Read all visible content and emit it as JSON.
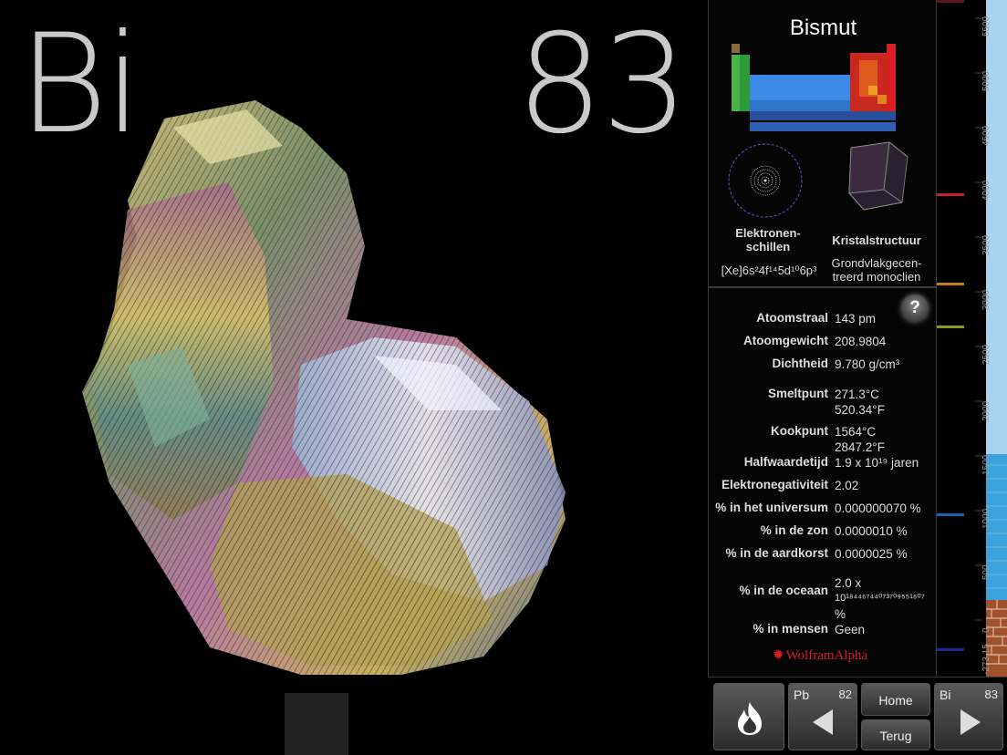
{
  "element": {
    "symbol": "Bi",
    "atomic_number": "83",
    "name": "Bismut"
  },
  "diagrams": {
    "shells_caption": [
      "Elektronen-",
      "schillen"
    ],
    "crystal_caption": "Kristalstructuur",
    "electron_config": "[Xe]6s²4f¹⁴5d¹⁰6p³",
    "crystal_structure": [
      "Grondvlakgecen-",
      "treerd monoclien"
    ]
  },
  "help_label": "?",
  "properties": [
    {
      "label": "Atoomstraal",
      "value": "143 pm"
    },
    {
      "label": "Atoomgewicht",
      "value": "208.9804"
    },
    {
      "label": "Dichtheid",
      "value": "9.780 g/cm³"
    },
    {
      "label": "Smeltpunt",
      "value": "271.3°C",
      "value2": "520.34°F"
    },
    {
      "label": "Kookpunt",
      "value": "1564°C",
      "value2": "2847.2°F"
    },
    {
      "label": "Halfwaardetijd",
      "value": "1.9 x 10¹⁹ jaren"
    },
    {
      "label": "Elektronegativiteit",
      "value": "2.02"
    },
    {
      "label": "% in het universum",
      "value": "0.000000070 %"
    },
    {
      "label": "% in de zon",
      "value": "0.0000010 %"
    },
    {
      "label": "% in de aardkorst",
      "value": "0.0000025 %"
    },
    {
      "label": "% in de oceaan",
      "value": "2.0 x",
      "value2": "10¹⁸⁴⁴⁶⁷⁴⁴⁰⁷³⁷⁰⁹⁵⁵¹⁶⁰⁷",
      "value3": "%"
    },
    {
      "label": "% in mensen",
      "value": "Geen"
    }
  ],
  "wolfram_label": "WolframAlpha",
  "thermometer": {
    "ticks": [
      "5500",
      "5000",
      "4500",
      "4000",
      "3500",
      "3000",
      "2500",
      "2000",
      "1500",
      "1000",
      "500",
      "0",
      "-273.15"
    ],
    "markers": [
      {
        "color": "#c8202a"
      },
      {
        "color": "#c77d1e"
      },
      {
        "color": "#8a9a1e"
      },
      {
        "color": "#1e5fae"
      },
      {
        "color": "#25259a"
      }
    ]
  },
  "nav": {
    "prev_symbol": "Pb",
    "prev_number": "82",
    "home_label": "Home",
    "back_label": "Terug",
    "next_symbol": "Bi",
    "next_number": "83"
  },
  "icons": {
    "flame": "flame-icon",
    "prev": "arrow-left-icon",
    "next": "arrow-right-icon"
  }
}
